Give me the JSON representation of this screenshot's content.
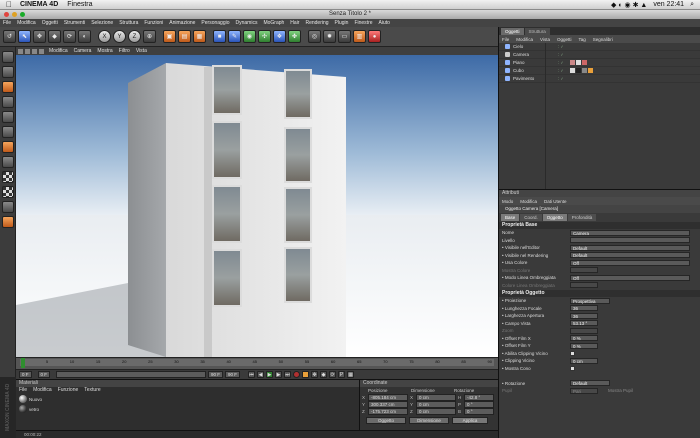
{
  "mac_menubar": {
    "apple_glyph": "",
    "app_name": "CINEMA 4D",
    "menu": "Finestra",
    "clock": "ven 22:41"
  },
  "window": {
    "title": "Senza Titolo 2 *",
    "menus": [
      "File",
      "Modifica",
      "Oggetti",
      "Strumenti",
      "Selezione",
      "Struttura",
      "Funzioni",
      "Animazione",
      "Personaggio",
      "Dynamics",
      "MoGraph",
      "Hair",
      "Rendering",
      "Plugin",
      "Finestre",
      "Aiuto"
    ]
  },
  "toolbar": {
    "buttons": [
      {
        "icon": "undo-icon",
        "glyph": "↺",
        "style": ""
      },
      {
        "icon": "live-selection-icon",
        "glyph": "⬉",
        "style": "b"
      },
      {
        "icon": "move-icon",
        "glyph": "✥",
        "style": ""
      },
      {
        "icon": "scale-icon",
        "glyph": "◆",
        "style": ""
      },
      {
        "icon": "rotate-icon",
        "glyph": "⟳",
        "style": ""
      },
      {
        "icon": "last-tool-icon",
        "glyph": "◐",
        "style": ""
      },
      {
        "icon": "x-axis-icon",
        "glyph": "X",
        "style": "c"
      },
      {
        "icon": "y-axis-icon",
        "glyph": "Y",
        "style": "c"
      },
      {
        "icon": "z-axis-icon",
        "glyph": "Z",
        "style": "c"
      },
      {
        "icon": "world-coordinates-icon",
        "glyph": "⊕",
        "style": ""
      },
      {
        "icon": "render-view-icon",
        "glyph": "▣",
        "style": "o"
      },
      {
        "icon": "render-picture-viewer-icon",
        "glyph": "▤",
        "style": "o"
      },
      {
        "icon": "render-settings-icon",
        "glyph": "▦",
        "style": "o"
      },
      {
        "icon": "cube-icon",
        "glyph": "■",
        "style": "b"
      },
      {
        "icon": "spline-pen-icon",
        "glyph": "✎",
        "style": "b"
      },
      {
        "icon": "nurbs-icon",
        "glyph": "◉",
        "style": "g"
      },
      {
        "icon": "array-icon",
        "glyph": "✣",
        "style": "g"
      },
      {
        "icon": "deformer-icon",
        "glyph": "❖",
        "style": "b"
      },
      {
        "icon": "scene-icon",
        "glyph": "✤",
        "style": "g"
      },
      {
        "icon": "camera-icon",
        "glyph": "◎",
        "style": ""
      },
      {
        "icon": "light-icon",
        "glyph": "✹",
        "style": ""
      },
      {
        "icon": "floor-icon",
        "glyph": "▭",
        "style": ""
      },
      {
        "icon": "grid-icon",
        "glyph": "▥",
        "style": "o"
      },
      {
        "icon": "record-icon",
        "glyph": "●",
        "style": "r"
      }
    ]
  },
  "left_tools": {
    "buttons": [
      {
        "icon": "make-editable-icon",
        "style": ""
      },
      {
        "icon": "model-mode-icon",
        "style": ""
      },
      {
        "icon": "object-axis-icon",
        "style": "o"
      },
      {
        "icon": "points-mode-icon",
        "style": ""
      },
      {
        "icon": "edges-mode-icon",
        "style": ""
      },
      {
        "icon": "polygons-mode-icon",
        "style": ""
      },
      {
        "icon": "texture-mode-icon",
        "style": "o"
      },
      {
        "icon": "workplane-icon",
        "style": ""
      },
      {
        "icon": "snap-icon",
        "style": "ck"
      },
      {
        "icon": "checker-icon",
        "style": "ck"
      },
      {
        "icon": "lock-icon",
        "style": ""
      },
      {
        "icon": "sculpt-icon",
        "style": "o"
      }
    ]
  },
  "viewport": {
    "menus": [
      "Modifica",
      "Camera",
      "Mostra",
      "Filtro",
      "Vista"
    ]
  },
  "timeline": {
    "ticks": [
      "0",
      "5",
      "10",
      "15",
      "20",
      "25",
      "30",
      "35",
      "40",
      "45",
      "50",
      "55",
      "60",
      "65",
      "70",
      "75",
      "80",
      "85",
      "90"
    ],
    "current_frame": "0 F",
    "start": "0 F",
    "end": "90 F",
    "end2": "90 F"
  },
  "materials": {
    "title": "Materiali",
    "menus": [
      "File",
      "Modifica",
      "Funzione",
      "Texture"
    ],
    "items": [
      {
        "name": "Nuovo",
        "dark": false
      },
      {
        "name": "vetro",
        "dark": true
      }
    ]
  },
  "coordinates": {
    "title": "Coordinate",
    "col_position": "Posizione",
    "col_size": "Dimensione",
    "col_rotation": "Rotazione",
    "rows": [
      {
        "axis": "X",
        "pos": "-805.184 cm",
        "size": "0 cm",
        "rot_axis": "H",
        "rot": "-42.8 °"
      },
      {
        "axis": "Y",
        "pos": "300.337 cm",
        "size": "0 cm",
        "rot_axis": "P",
        "rot": "0 °"
      },
      {
        "axis": "Z",
        "pos": "-175.723 cm",
        "size": "0 cm",
        "rot_axis": "B",
        "rot": "0 °"
      }
    ],
    "mode1": "Oggetto",
    "mode2": "Dimensione",
    "apply": "Applica"
  },
  "status": {
    "time": "00:00:22"
  },
  "side_label": "MAXON CINEMA 4D",
  "objects": {
    "tabs": [
      {
        "label": "Oggetti",
        "active": true
      },
      {
        "label": "Struttura",
        "active": false
      }
    ],
    "menus": [
      "File",
      "Modifica",
      "Vista",
      "Oggetti",
      "Tag",
      "Segnalibri"
    ],
    "items": [
      {
        "name": "Cielo",
        "color": "#8fb5ff",
        "tags": []
      },
      {
        "name": "Camera",
        "color": "#ccc",
        "tags": []
      },
      {
        "name": "Piano",
        "color": "#8fb5ff",
        "tags": [
          "#c88",
          "#ddd",
          "#c66"
        ]
      },
      {
        "name": "Cubo",
        "color": "#8fb5ff",
        "tags": [
          "#ddd",
          "#222",
          "#888",
          "#e9a03a"
        ]
      },
      {
        "name": "Pavimento",
        "color": "#8fb5ff",
        "tags": []
      }
    ]
  },
  "attributes": {
    "title": "Attributi",
    "menus": [
      "Modo",
      "Modifica",
      "Dati Utente"
    ],
    "object_name": "Oggetto Camera [Camera]",
    "tabs": [
      {
        "label": "Base",
        "active": true
      },
      {
        "label": "Coord.",
        "active": false
      },
      {
        "label": "Oggetto",
        "active": true
      },
      {
        "label": "Profondità",
        "active": false
      }
    ],
    "section1": "Proprietà Base",
    "basic": [
      {
        "label": "Nome",
        "value": "Camera",
        "dim": false,
        "w": "wide"
      },
      {
        "label": "Livello",
        "value": "",
        "dim": false,
        "w": "wide"
      },
      {
        "label": "• Visibile nell'Editor",
        "value": "Default",
        "dim": false,
        "w": "wide"
      },
      {
        "label": "• Visibile nel Rendering",
        "value": "Default",
        "dim": false,
        "w": "wide"
      },
      {
        "label": "• Usa Colore",
        "value": "Off",
        "dim": false,
        "w": "wide"
      },
      {
        "label": "Mostra Colore",
        "value": "",
        "dim": true,
        "w": "short"
      },
      {
        "label": "• Modo Linea Ombreggiata",
        "value": "Off",
        "dim": false,
        "w": "wide"
      },
      {
        "label": "Colore Linea Ombreggiata",
        "value": "",
        "dim": true,
        "w": "short"
      }
    ],
    "section2": "Proprietà Oggetto",
    "object_props": [
      {
        "label": "• Proiezione",
        "value": "Prospettiva",
        "type": "val",
        "w": "mid"
      },
      {
        "label": "• Lunghezza Focale",
        "value": "36",
        "type": "val",
        "w": "short"
      },
      {
        "label": "• Larghezza Apertura",
        "value": "36",
        "type": "val",
        "w": "short"
      },
      {
        "label": "• Campo Vista",
        "value": "53.13 °",
        "type": "val",
        "w": "short"
      },
      {
        "label": "Zoom",
        "value": "",
        "type": "dim",
        "w": "short"
      },
      {
        "label": "• Offset Film X",
        "value": "0 %",
        "type": "val",
        "w": "short"
      },
      {
        "label": "• Offset Film Y",
        "value": "0 %",
        "type": "val",
        "w": "short"
      },
      {
        "label": "• Abilita Clipping Vicino",
        "value": "",
        "type": "chk",
        "w": "short"
      },
      {
        "label": "• Clipping Vicino",
        "value": "0 cm",
        "type": "val",
        "w": "short"
      },
      {
        "label": "• Mostra Cono",
        "value": "",
        "type": "chk",
        "w": "short"
      },
      {
        "label": "",
        "value": "",
        "type": "blank",
        "w": "short"
      },
      {
        "label": "• Rotazione",
        "value": "Default",
        "type": "val",
        "w": "mid"
      },
      {
        "label": "Pupil",
        "value": "Pari",
        "type": "dim",
        "w": "short",
        "extra": "Mostra Pupil"
      }
    ]
  }
}
